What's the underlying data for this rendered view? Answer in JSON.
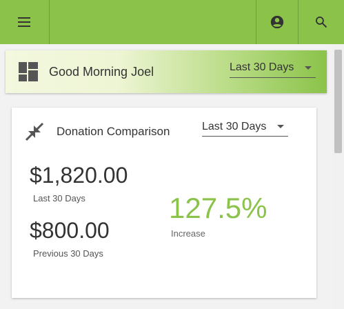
{
  "appbar": {
    "menu_icon": "hamburger-menu-icon",
    "account_icon": "account-circle-icon",
    "search_icon": "search-icon",
    "color": "#8bc34a"
  },
  "greeting": {
    "text": "Good Morning Joel",
    "icon": "dashboard-icon",
    "period_select": "Last 30 Days"
  },
  "donation_card": {
    "title": "Donation Comparison",
    "icon": "compress-arrows-icon",
    "period_select": "Last 30 Days",
    "current_amount": "$1,820.00",
    "current_label": "Last 30 Days",
    "previous_amount": "$800.00",
    "previous_label": "Previous 30 Days",
    "change_percent": "127.5%",
    "change_label": "Increase",
    "accent_color": "#8bc34a"
  }
}
